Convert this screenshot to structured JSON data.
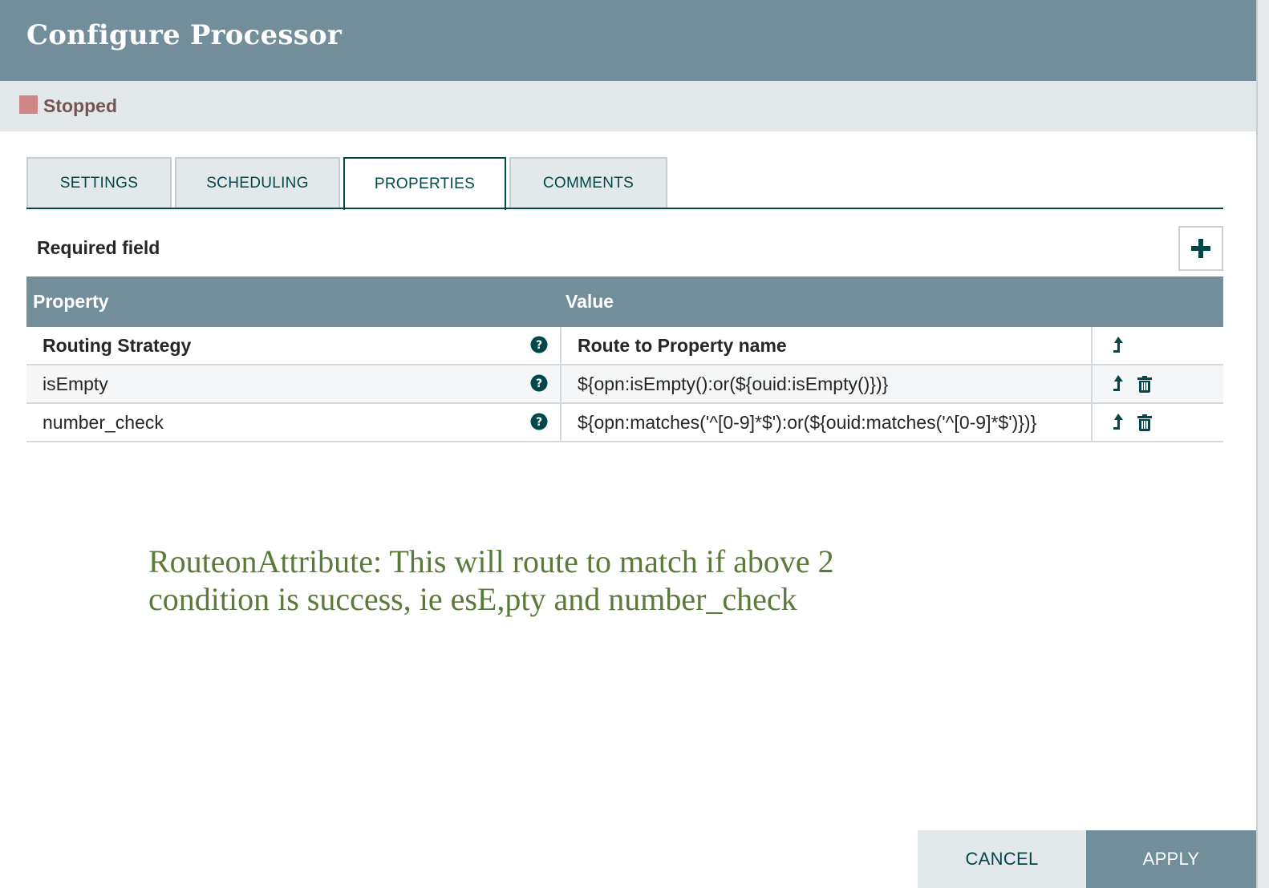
{
  "dialog": {
    "title": "Configure Processor",
    "status": "Stopped"
  },
  "tabs": [
    {
      "label": "SETTINGS",
      "active": false
    },
    {
      "label": "SCHEDULING",
      "active": false
    },
    {
      "label": "PROPERTIES",
      "active": true
    },
    {
      "label": "COMMENTS",
      "active": false
    }
  ],
  "properties": {
    "required_label": "Required field",
    "add_icon": "plus-icon",
    "columns": [
      "Property",
      "Value"
    ],
    "rows": [
      {
        "name": "Routing Strategy",
        "value": "Route to Property name",
        "required": true,
        "deletable": false
      },
      {
        "name": "isEmpty",
        "value": "${opn:isEmpty():or(${ouid:isEmpty()})}",
        "required": false,
        "deletable": true
      },
      {
        "name": "number_check",
        "value": "${opn:matches('^[0-9]*$'):or(${ouid:matches('^[0-9]*$')})}",
        "required": false,
        "deletable": true
      }
    ]
  },
  "annotation": {
    "line1": "RouteonAttribute: This will route to match if above 2",
    "line2": "condition is success, ie esE,pty and number_check"
  },
  "footer": {
    "cancel_label": "CANCEL",
    "apply_label": "APPLY"
  },
  "colors": {
    "header": "#728e9b",
    "accent": "#004849",
    "stopped": "#d18686",
    "annotation": "#5a7a39"
  }
}
